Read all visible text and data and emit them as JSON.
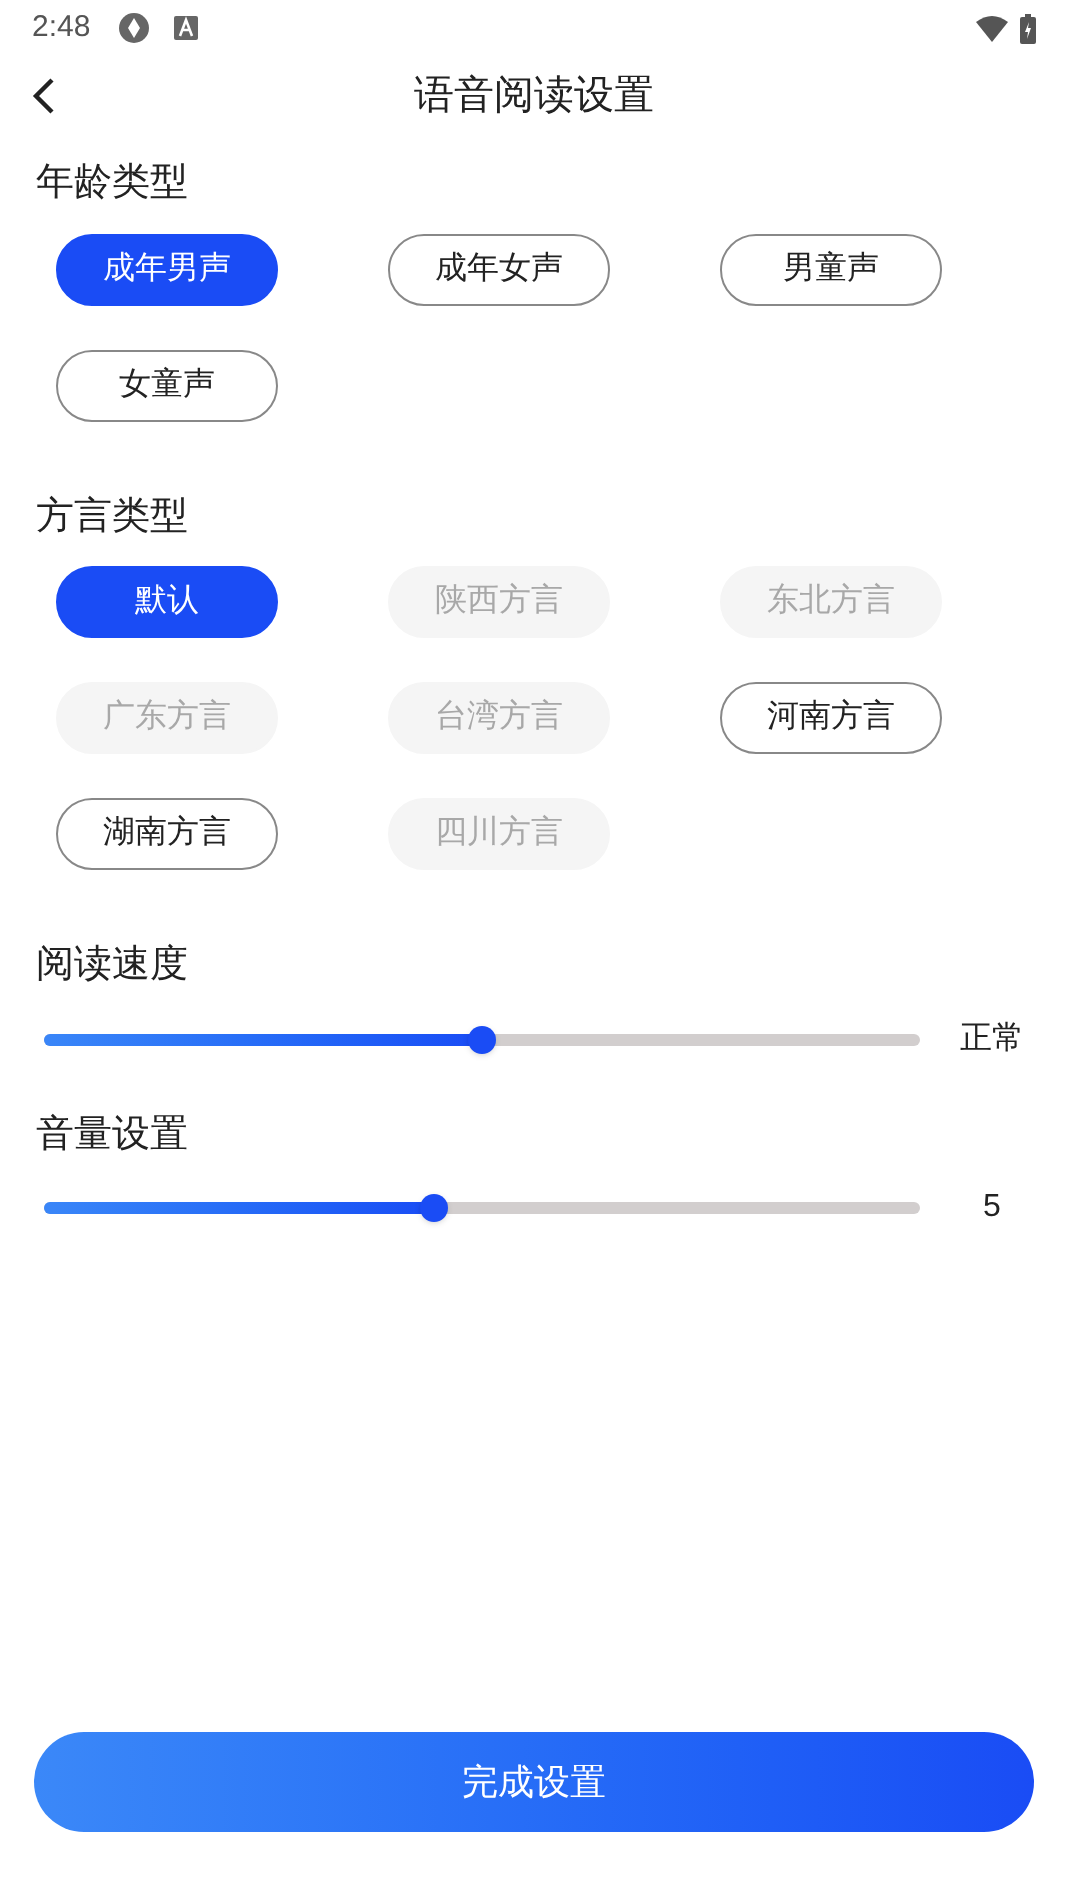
{
  "status_bar": {
    "time": "2:48"
  },
  "header": {
    "title": "语音阅读设置"
  },
  "sections": [
    {
      "kind": "chips",
      "title": "年龄类型",
      "options": [
        {
          "label": "成年男声",
          "selected": true,
          "disabled": false
        },
        {
          "label": "成年女声",
          "selected": false,
          "disabled": false
        },
        {
          "label": "男童声",
          "selected": false,
          "disabled": false
        },
        {
          "label": "女童声",
          "selected": false,
          "disabled": false
        }
      ]
    },
    {
      "kind": "chips",
      "title": "方言类型",
      "options": [
        {
          "label": "默认",
          "selected": true,
          "disabled": false
        },
        {
          "label": "陕西方言",
          "selected": false,
          "disabled": true
        },
        {
          "label": "东北方言",
          "selected": false,
          "disabled": true
        },
        {
          "label": "广东方言",
          "selected": false,
          "disabled": true
        },
        {
          "label": "台湾方言",
          "selected": false,
          "disabled": true
        },
        {
          "label": "河南方言",
          "selected": false,
          "disabled": false
        },
        {
          "label": "湖南方言",
          "selected": false,
          "disabled": false
        },
        {
          "label": "四川方言",
          "selected": false,
          "disabled": true
        }
      ]
    },
    {
      "kind": "slider",
      "title": "阅读速度",
      "level": 0.5,
      "reading": "正常"
    },
    {
      "kind": "slider",
      "title": "音量设置",
      "level": 0.445,
      "reading": "5"
    }
  ],
  "done_button": "完成设置"
}
